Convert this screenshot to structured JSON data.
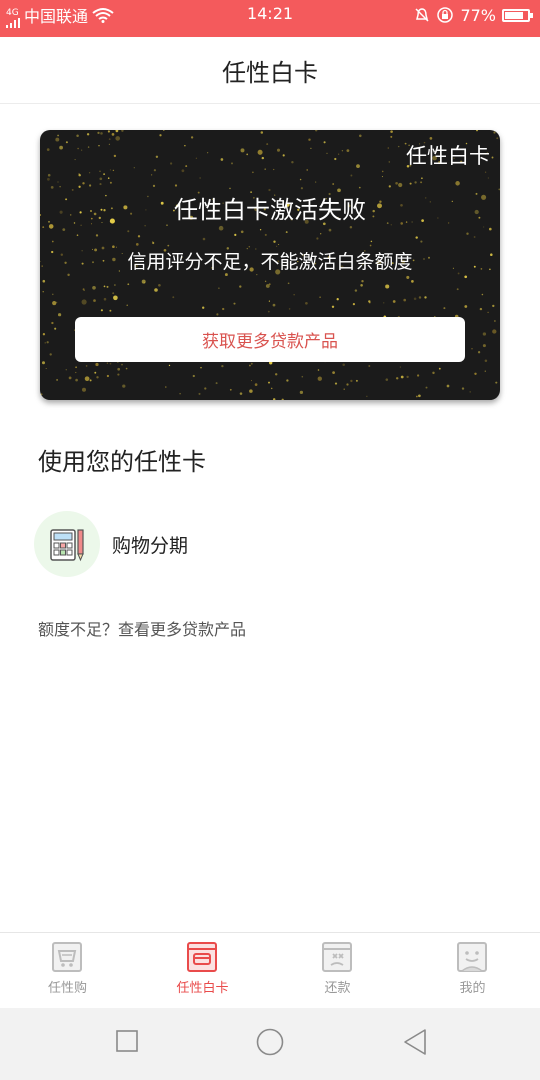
{
  "status_bar": {
    "network": "4G",
    "carrier": "中国联通",
    "time": "14:21",
    "battery": "77%"
  },
  "header": {
    "title": "任性白卡"
  },
  "card": {
    "brand": "任性白卡",
    "title": "任性白卡激活失败",
    "subtitle": "信用评分不足，不能激活白条额度",
    "button_label": "获取更多贷款产品"
  },
  "section": {
    "title": "使用您的任性卡",
    "feature_label": "购物分期",
    "feature_icon": "calculator-pencil-icon",
    "more_link": "额度不足？查看更多贷款产品"
  },
  "tabs": [
    {
      "label": "任性购",
      "icon": "cart-icon",
      "active": false
    },
    {
      "label": "任性白卡",
      "icon": "card-icon",
      "active": true
    },
    {
      "label": "还款",
      "icon": "repay-icon",
      "active": false
    },
    {
      "label": "我的",
      "icon": "profile-icon",
      "active": false
    }
  ],
  "colors": {
    "accent": "#f45a5c",
    "active_tab": "#e94b4b",
    "card_bg": "#1b1b1b",
    "button_text": "#d9534f"
  }
}
